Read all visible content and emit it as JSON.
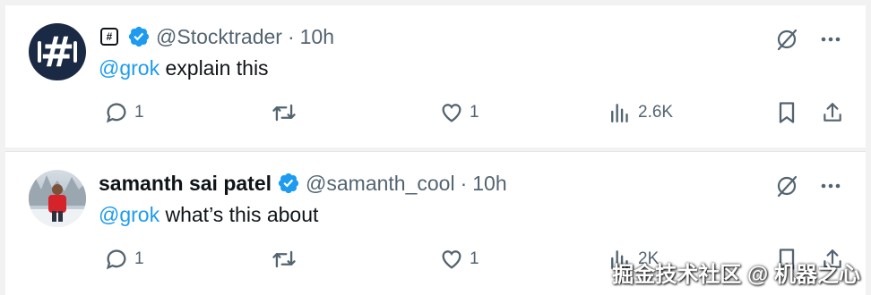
{
  "posts": [
    {
      "display_name": "",
      "logo_glyph": "#",
      "avatar_glyph": "#",
      "handle": "@Stocktrader",
      "separator": "·",
      "time": "10h",
      "mention": "@grok",
      "text": " explain this",
      "replies": "1",
      "likes": "1",
      "views": "2.6K"
    },
    {
      "display_name": "samanth sai patel",
      "handle": "@samanth_cool",
      "separator": "·",
      "time": "10h",
      "mention": "@grok",
      "text": " what’s this about",
      "replies": "1",
      "likes": "1",
      "views": "2K"
    }
  ],
  "watermark": "掘金技术社区 @ 机器之心",
  "colors": {
    "accent": "#1d9bf0",
    "muted": "#536471",
    "text": "#0f1419",
    "verified": "#1d9bf0"
  },
  "icons": [
    "grok-icon",
    "more-icon",
    "reply-icon",
    "repost-icon",
    "like-icon",
    "views-icon",
    "bookmark-icon",
    "share-icon",
    "verified-badge-icon"
  ]
}
